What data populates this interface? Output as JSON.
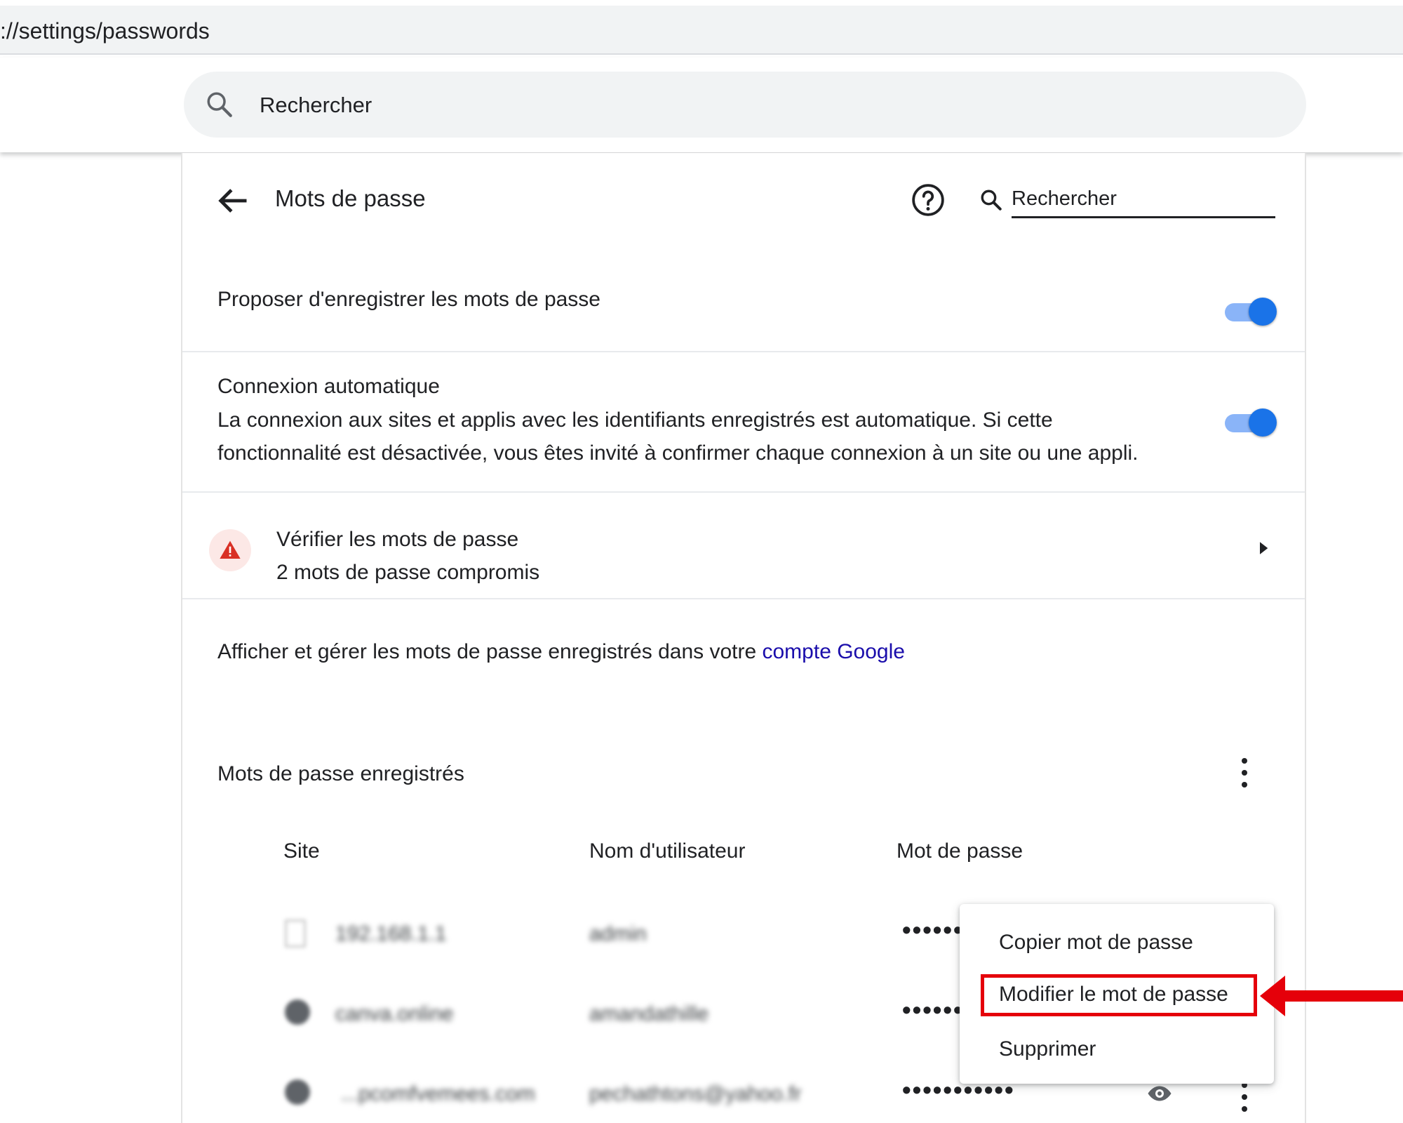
{
  "browser": {
    "url": "://settings/passwords"
  },
  "top_search": {
    "placeholder": "Rechercher"
  },
  "passwords_page": {
    "title": "Mots de passe",
    "search_placeholder": "Rechercher",
    "offer_save": {
      "label": "Proposer d'enregistrer les mots de passe",
      "enabled": true
    },
    "auto_signin": {
      "label": "Connexion automatique",
      "description_line1": "La connexion aux sites et applis avec les identifiants enregistrés est automatique. Si cette",
      "description_line2": "fonctionnalité est désactivée, vous êtes invité à confirmer chaque connexion à un site ou une appli.",
      "enabled": true
    },
    "check_passwords": {
      "title": "Vérifier les mots de passe",
      "subtitle": "2 mots de passe compromis"
    },
    "manage": {
      "text": "Afficher et gérer les mots de passe enregistrés dans votre ",
      "link": "compte Google"
    },
    "saved": {
      "title": "Mots de passe enregistrés",
      "columns": {
        "site": "Site",
        "username": "Nom d'utilisateur",
        "password": "Mot de passe"
      },
      "rows": [
        {
          "site": "192.168.1.1",
          "username": "admin",
          "password": "••••••"
        },
        {
          "site": "canva.online",
          "username": "amandathille",
          "password": "••••••"
        },
        {
          "site": "...pcomfvemees.com",
          "username": "pechathtons@yahoo.fr",
          "password": "•••••••••••"
        }
      ]
    },
    "context_menu": {
      "items": [
        "Copier mot de passe",
        "Modifier le mot de passe",
        "Supprimer"
      ]
    }
  },
  "colors": {
    "accent": "#1a73e8",
    "toggle_track": "#8ab4f8",
    "warning": "#d93025",
    "annotation": "#e5000a",
    "link": "#1a0dab"
  }
}
